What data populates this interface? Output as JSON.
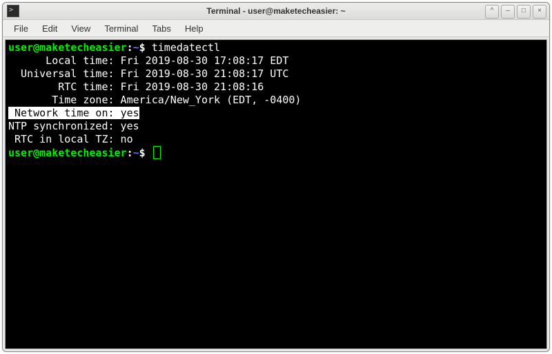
{
  "window": {
    "title": "Terminal - user@maketecheasier: ~"
  },
  "menu": {
    "file": "File",
    "edit": "Edit",
    "view": "View",
    "terminal": "Terminal",
    "tabs": "Tabs",
    "help": "Help"
  },
  "winbtns": {
    "up": "^",
    "min": "–",
    "max": "□",
    "close": "×"
  },
  "prompt": {
    "userhost": "user@maketecheasier",
    "sep": ":",
    "path": "~",
    "sym": "$"
  },
  "cmd": {
    "first": " timedatectl"
  },
  "out": {
    "local": "      Local time: Fri 2019-08-30 17:08:17 EDT",
    "univ": "  Universal time: Fri 2019-08-30 21:08:17 UTC",
    "rtc": "        RTC time: Fri 2019-08-30 21:08:16",
    "tz": "       Time zone: America/New_York (EDT, -0400)",
    "net_lbl": " Network time on: ",
    "net_val": "yes",
    "ntp": "NTP synchronized: yes",
    "rtctz": " RTC in local TZ: no"
  }
}
